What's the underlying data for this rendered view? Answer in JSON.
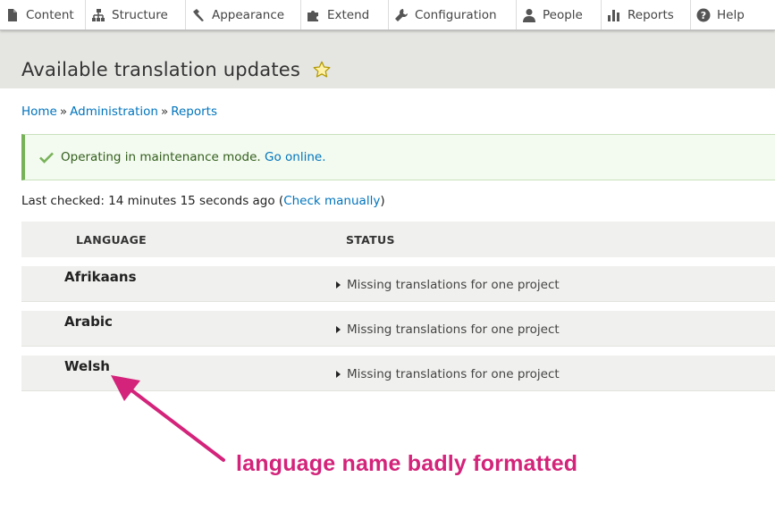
{
  "toolbar": {
    "items": [
      {
        "label": "Content",
        "icon": "content-icon"
      },
      {
        "label": "Structure",
        "icon": "structure-icon"
      },
      {
        "label": "Appearance",
        "icon": "appearance-icon"
      },
      {
        "label": "Extend",
        "icon": "extend-icon"
      },
      {
        "label": "Configuration",
        "icon": "wrench-icon"
      },
      {
        "label": "People",
        "icon": "people-icon"
      },
      {
        "label": "Reports",
        "icon": "reports-icon"
      },
      {
        "label": "Help",
        "icon": "help-icon"
      }
    ]
  },
  "page": {
    "title": "Available translation updates",
    "favorite_icon": "star-icon"
  },
  "breadcrumb": {
    "items": [
      "Home",
      "Administration",
      "Reports"
    ],
    "separator": "»"
  },
  "message": {
    "text": "Operating in maintenance mode.",
    "link": "Go online."
  },
  "last_checked": {
    "prefix": "Last checked: 14 minutes 15 seconds ago (",
    "link": "Check manually",
    "suffix": ")"
  },
  "table": {
    "headers": [
      "LANGUAGE",
      "STATUS"
    ],
    "rows": [
      {
        "language": "Afrikaans",
        "status": "Missing translations for one project"
      },
      {
        "language": "Arabic",
        "status": "Missing translations for one project"
      },
      {
        "language": "Welsh",
        "status": "Missing translations for one project"
      }
    ]
  },
  "annotation": {
    "text": "language name badly formatted",
    "color": "#d3237a"
  },
  "colors": {
    "link": "#0074bd",
    "status_ok_border": "#77b259",
    "header_bg": "#e5e5e2"
  }
}
